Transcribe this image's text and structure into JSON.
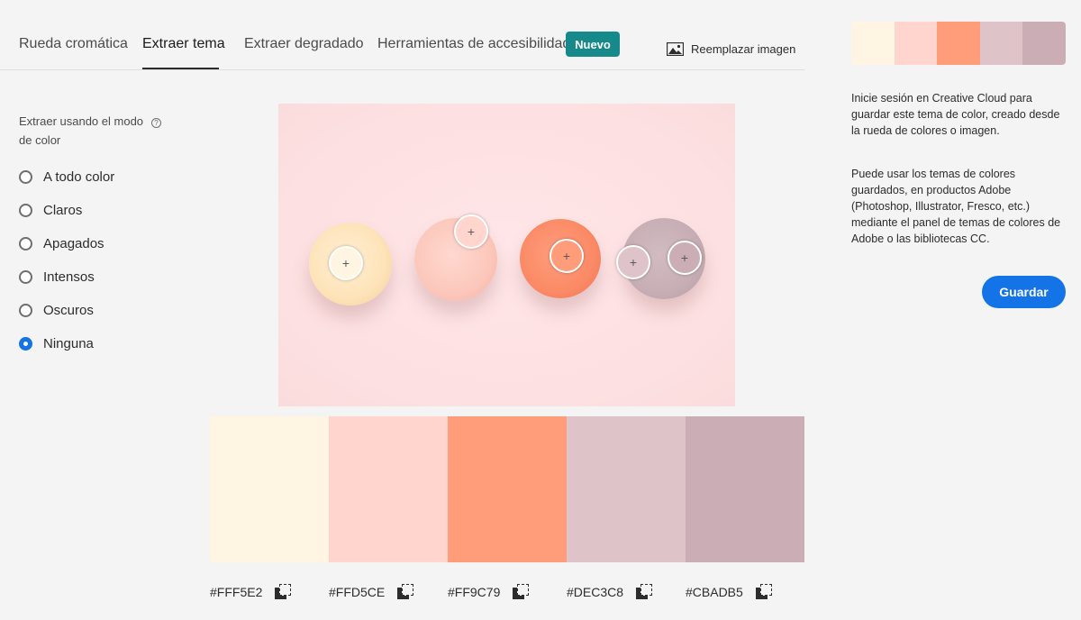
{
  "tabs": [
    {
      "label": "Rueda cromática"
    },
    {
      "label": "Extraer tema"
    },
    {
      "label": "Extraer degradado"
    },
    {
      "label": "Herramientas de accesibilidad"
    }
  ],
  "active_tab": "Extraer tema",
  "new_badge": "Nuevo",
  "replace_image": "Reemplazar imagen",
  "mode": {
    "label": "Extraer usando el modo de color",
    "help_icon": "?",
    "options": [
      "A todo color",
      "Claros",
      "Apagados",
      "Intensos",
      "Oscuros",
      "Ninguna"
    ],
    "selected": "Ninguna"
  },
  "swatches": [
    {
      "hex": "#FFF5E2",
      "color": "#FFF5E2"
    },
    {
      "hex": "#FFD5CE",
      "color": "#FFD5CE"
    },
    {
      "hex": "#FF9C79",
      "color": "#FF9C79"
    },
    {
      "hex": "#DEC3C8",
      "color": "#DEC3C8"
    },
    {
      "hex": "#CBADB5",
      "color": "#CBADB5"
    }
  ],
  "picker_glyph": "+",
  "right_panel": {
    "info1": "Inicie sesión en Creative Cloud para guardar este tema de color, creado desde la rueda de colores o imagen.",
    "info2": "Puede usar los temas de colores guardados, en productos Adobe (Photoshop, Illustrator, Fresco, etc.) mediante el panel de temas de colores de Adobe o las bibliotecas CC.",
    "save_label": "Guardar"
  },
  "colors": {
    "accent": "#1473e6",
    "badge": "#168a8a"
  }
}
